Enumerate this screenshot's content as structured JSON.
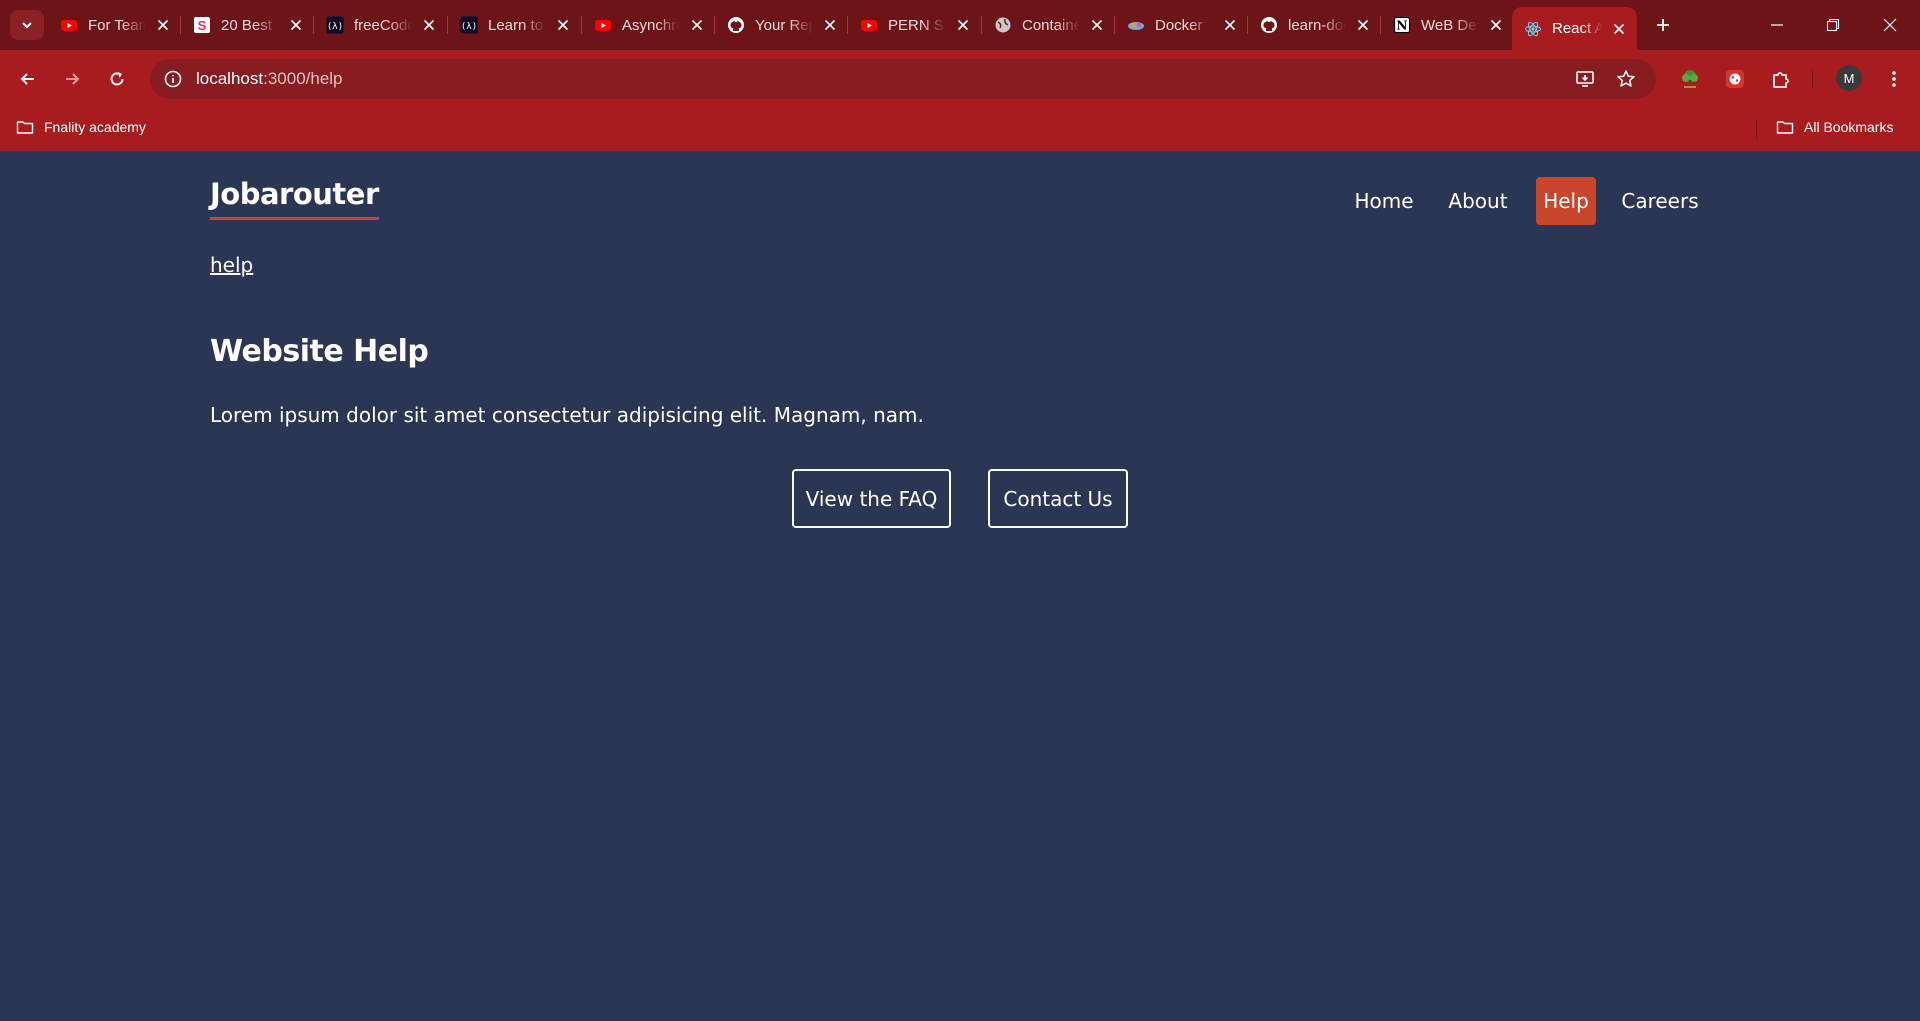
{
  "browser": {
    "tabs": [
      {
        "title": "For Teams",
        "icon": "youtube-icon",
        "color": "#ff0000"
      },
      {
        "title": "20 Best",
        "icon": "s-brand-icon",
        "color": "#e8335c"
      },
      {
        "title": "freeCodeCamp",
        "icon": "freecodecamp-icon",
        "color": "#0a0a23"
      },
      {
        "title": "Learn to Code",
        "icon": "freecodecamp-icon",
        "color": "#0a0a23"
      },
      {
        "title": "Asynchronous",
        "icon": "youtube-icon",
        "color": "#ff0000"
      },
      {
        "title": "Your Repositories",
        "icon": "github-icon",
        "color": "#ffffff"
      },
      {
        "title": "PERN Stack",
        "icon": "youtube-icon",
        "color": "#ff0000"
      },
      {
        "title": "Containers",
        "icon": "globe-icon",
        "color": "#c9c9c9"
      },
      {
        "title": "Docker",
        "icon": "docker-icon",
        "color": "#6fa8dc"
      },
      {
        "title": "learn-docker",
        "icon": "github-icon",
        "color": "#ffffff"
      },
      {
        "title": "WeB Dev",
        "icon": "notion-icon",
        "color": "#ffffff"
      },
      {
        "title": "React App",
        "icon": "react-icon",
        "color": "#61dafb",
        "active": true
      }
    ],
    "url_host": "localhost",
    "url_path": ":3000/help",
    "bookmarks": {
      "folder": "Fnality academy",
      "all": "All Bookmarks"
    },
    "profile_initial": "M",
    "accent": "#a81c1f",
    "tabstrip_color": "#6d1418"
  },
  "site": {
    "brand": "Jobarouter",
    "nav": [
      {
        "label": "Home"
      },
      {
        "label": "About"
      },
      {
        "label": "Help",
        "active": true
      },
      {
        "label": "Careers"
      }
    ],
    "breadcrumb": "help",
    "heading": "Website Help",
    "body": "Lorem ipsum dolor sit amet consectetur adipisicing elit. Magnam, nam.",
    "buttons": {
      "faq": "View the FAQ",
      "contact": "Contact Us"
    },
    "bg_color": "#2b3554",
    "accent": "#c8472c"
  }
}
